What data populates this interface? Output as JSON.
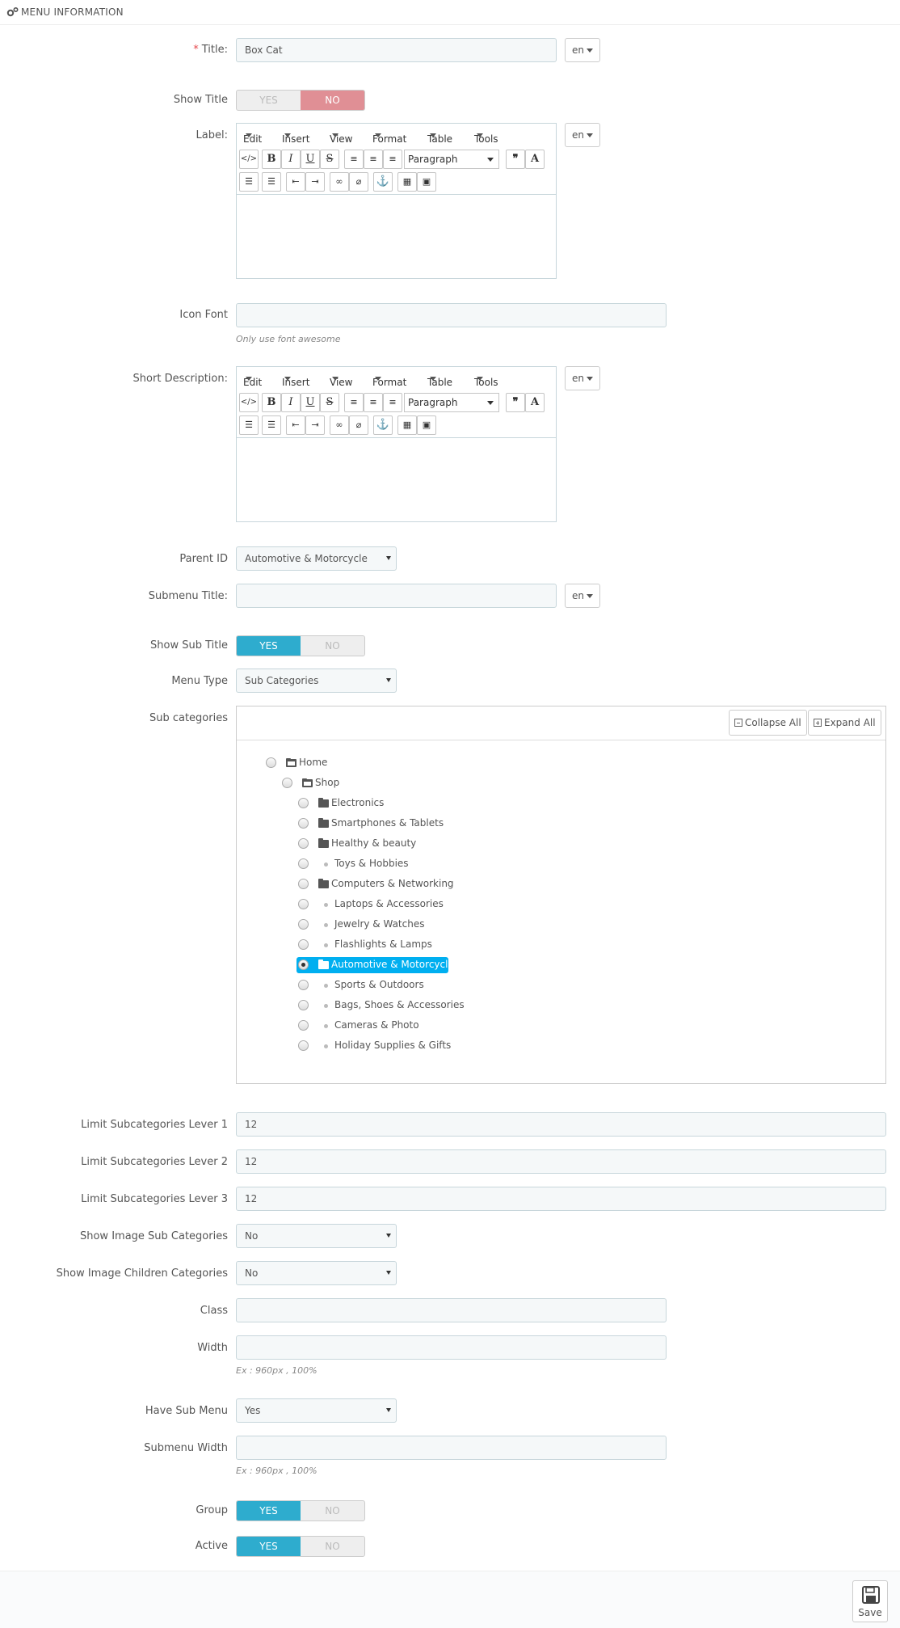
{
  "panel": {
    "title": "Menu Information",
    "icon": "cogs-icon"
  },
  "title_field": {
    "required_mark": "*",
    "label": "Title:",
    "value": "Box Cat",
    "lang": "en"
  },
  "show_title": {
    "label": "Show Title",
    "yes": "YES",
    "no": "NO",
    "selected": "NO"
  },
  "label_field": {
    "label": "Label:",
    "lang": "en"
  },
  "editor": {
    "menus": [
      "Edit",
      "Insert",
      "View",
      "Format",
      "Table",
      "Tools"
    ],
    "format_select": "Paragraph",
    "row1_icons": [
      "source-code-icon",
      "bold-icon",
      "italic-icon",
      "underline-icon",
      "strikethrough-icon",
      "align-left-icon",
      "align-center-icon",
      "align-right-icon",
      "blockquote-icon",
      "text-color-icon"
    ],
    "row2_icons": [
      "bullet-list-icon",
      "numbered-list-icon",
      "outdent-icon",
      "indent-icon",
      "link-icon",
      "unlink-icon",
      "anchor-icon",
      "media-icon",
      "image-icon"
    ]
  },
  "icon_font": {
    "label": "Icon Font",
    "value": "",
    "help": "Only use font awesome"
  },
  "short_description": {
    "label": "Short Description:",
    "lang": "en"
  },
  "parent_id": {
    "label": "Parent ID",
    "value": "Automotive & Motorcycle"
  },
  "submenu_title": {
    "label": "Submenu Title:",
    "value": "",
    "lang": "en"
  },
  "show_sub_title": {
    "label": "Show Sub Title",
    "yes": "YES",
    "no": "NO",
    "selected": "YES"
  },
  "menu_type": {
    "label": "Menu Type",
    "value": "Sub Categories"
  },
  "sub_categories": {
    "label": "Sub categories",
    "collapse_all": "Collapse All",
    "expand_all": "Expand All",
    "tree": [
      {
        "name": "Home",
        "level": 0,
        "icon": "folder-open-icon",
        "checked": false
      },
      {
        "name": "Shop",
        "level": 1,
        "icon": "folder-open-icon",
        "checked": false
      },
      {
        "name": "Electronics",
        "level": 2,
        "icon": "folder-icon",
        "checked": false
      },
      {
        "name": "Smartphones & Tablets",
        "level": 2,
        "icon": "folder-icon",
        "checked": false
      },
      {
        "name": "Healthy & beauty",
        "level": 2,
        "icon": "folder-icon",
        "checked": false
      },
      {
        "name": "Toys & Hobbies",
        "level": 2,
        "icon": "bullet-icon",
        "checked": false
      },
      {
        "name": "Computers & Networking",
        "level": 2,
        "icon": "folder-icon",
        "checked": false
      },
      {
        "name": "Laptops & Accessories",
        "level": 2,
        "icon": "bullet-icon",
        "checked": false
      },
      {
        "name": "Jewelry & Watches",
        "level": 2,
        "icon": "bullet-icon",
        "checked": false
      },
      {
        "name": "Flashlights & Lamps",
        "level": 2,
        "icon": "bullet-icon",
        "checked": false
      },
      {
        "name": "Automotive & Motorcycle",
        "level": 2,
        "icon": "folder-icon",
        "checked": true
      },
      {
        "name": "Sports & Outdoors",
        "level": 2,
        "icon": "bullet-icon",
        "checked": false
      },
      {
        "name": "Bags, Shoes & Accessories",
        "level": 2,
        "icon": "bullet-icon",
        "checked": false
      },
      {
        "name": "Cameras & Photo",
        "level": 2,
        "icon": "bullet-icon",
        "checked": false
      },
      {
        "name": "Holiday Supplies & Gifts",
        "level": 2,
        "icon": "bullet-icon",
        "checked": false
      }
    ]
  },
  "limit_lever_1": {
    "label": "Limit Subcategories Lever 1",
    "value": "12"
  },
  "limit_lever_2": {
    "label": "Limit Subcategories Lever 2",
    "value": "12"
  },
  "limit_lever_3": {
    "label": "Limit Subcategories Lever 3",
    "value": "12"
  },
  "show_image_sub": {
    "label": "Show Image Sub Categories",
    "value": "No"
  },
  "show_image_children": {
    "label": "Show Image Children Categories",
    "value": "No"
  },
  "class_field": {
    "label": "Class",
    "value": ""
  },
  "width_field": {
    "label": "Width",
    "value": "",
    "help": "Ex : 960px , 100%"
  },
  "have_sub_menu": {
    "label": "Have Sub Menu",
    "value": "Yes"
  },
  "submenu_width": {
    "label": "Submenu Width",
    "value": "",
    "help": "Ex : 960px , 100%"
  },
  "group": {
    "label": "Group",
    "yes": "YES",
    "no": "NO",
    "selected": "YES"
  },
  "active": {
    "label": "Active",
    "yes": "YES",
    "no": "NO",
    "selected": "YES"
  },
  "footer": {
    "save": "Save"
  },
  "colors": {
    "accent_blue": "#2eacce",
    "no_red": "#e08f95",
    "tree_selected": "#00aff0"
  }
}
